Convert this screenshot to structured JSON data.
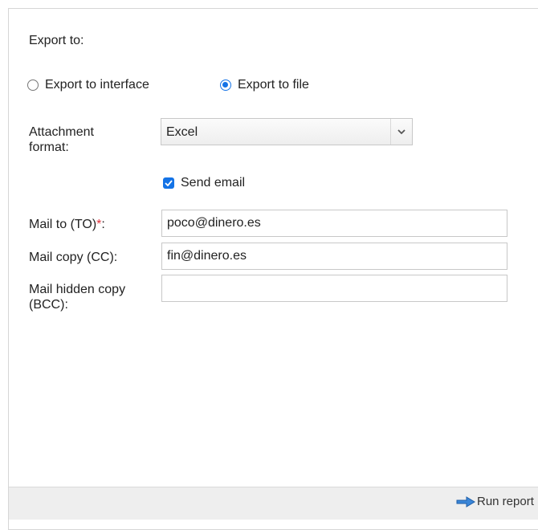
{
  "export_section": {
    "title": "Export to:",
    "options": [
      {
        "label": "Export to interface",
        "selected": false
      },
      {
        "label": "Export to file",
        "selected": true
      }
    ]
  },
  "attachment": {
    "label": "Attachment format:",
    "value": "Excel"
  },
  "send_email": {
    "label": "Send email",
    "checked": true
  },
  "mail_to": {
    "label": "Mail to (TO)",
    "required_mark": "*",
    "label_suffix": ":",
    "value": "poco@dinero.es"
  },
  "mail_cc": {
    "label": "Mail copy (CC):",
    "value": "fin@dinero.es"
  },
  "mail_bcc": {
    "label": "Mail hidden copy (BCC):",
    "value": ""
  },
  "footer": {
    "run_label": "Run report"
  },
  "colors": {
    "accent": "#1473e6",
    "required": "#e0303a",
    "footer_bg": "#eeeeee"
  }
}
